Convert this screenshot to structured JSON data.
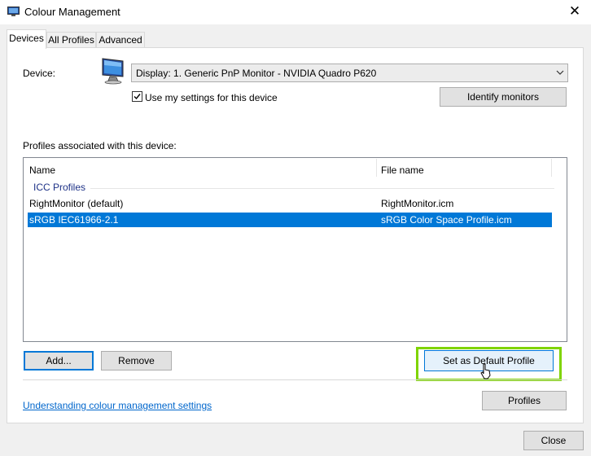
{
  "window": {
    "title": "Colour Management",
    "close_glyph": "✕"
  },
  "tabs": [
    {
      "label": "Devices",
      "selected": true
    },
    {
      "label": "All Profiles",
      "selected": false
    },
    {
      "label": "Advanced",
      "selected": false
    }
  ],
  "device": {
    "label": "Device:",
    "selected": "Display: 1. Generic PnP Monitor - NVIDIA Quadro P620",
    "use_my_settings_label": "Use my settings for this device",
    "use_my_settings_checked": true,
    "identify_button": "Identify monitors"
  },
  "profiles": {
    "section_label": "Profiles associated with this device:",
    "columns": [
      "Name",
      "File name"
    ],
    "group": "ICC Profiles",
    "rows": [
      {
        "name": "RightMonitor (default)",
        "file": "RightMonitor.icm",
        "selected": false
      },
      {
        "name": "sRGB IEC61966-2.1",
        "file": "sRGB Color Space Profile.icm",
        "selected": true
      }
    ],
    "add_button": "Add...",
    "remove_button": "Remove",
    "set_default_button": "Set as Default Profile"
  },
  "footer": {
    "link": "Understanding colour management settings",
    "profiles_button": "Profiles",
    "close_button": "Close"
  },
  "colors": {
    "selection": "#0078d7",
    "highlight": "#7fd400",
    "link": "#0066cc"
  },
  "icons": [
    "app-icon",
    "monitor-icon",
    "chevron-down-icon",
    "checkmark-icon",
    "close-icon",
    "cursor-icon"
  ]
}
